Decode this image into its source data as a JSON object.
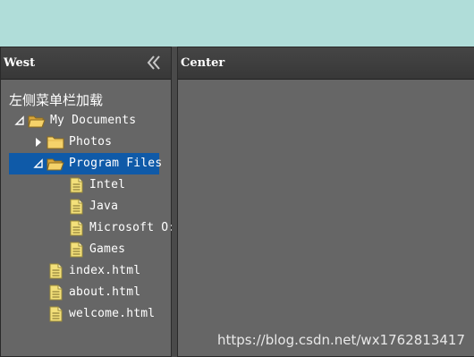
{
  "west": {
    "title": "West",
    "tree_caption": "左侧菜单栏加载",
    "tree": [
      {
        "label": "My Documents",
        "level": 0,
        "icon": "folder-open-icon",
        "expander": "expanded"
      },
      {
        "label": "Photos",
        "level": 1,
        "icon": "folder-icon",
        "expander": "collapsed"
      },
      {
        "label": "Program Files",
        "level": 1,
        "icon": "folder-open-icon",
        "expander": "expanded",
        "selected": true
      },
      {
        "label": "Intel",
        "level": 2,
        "icon": "file-icon"
      },
      {
        "label": "Java",
        "level": 2,
        "icon": "file-icon"
      },
      {
        "label": "Microsoft O:",
        "level": 2,
        "icon": "file-icon"
      },
      {
        "label": "Games",
        "level": 2,
        "icon": "file-icon"
      },
      {
        "label": "index.html",
        "level": 1,
        "icon": "file-icon"
      },
      {
        "label": "about.html",
        "level": 1,
        "icon": "file-icon"
      },
      {
        "label": "welcome.html",
        "level": 1,
        "icon": "file-icon"
      }
    ]
  },
  "center": {
    "title": "Center"
  },
  "watermark": "https://blog.csdn.net/wx1762813417",
  "colors": {
    "north_bg": "#b0ddd9",
    "panel_bg": "#666666",
    "selection": "#0f5aa8",
    "folder": "#f5d26a",
    "file": "#f3e07a"
  }
}
